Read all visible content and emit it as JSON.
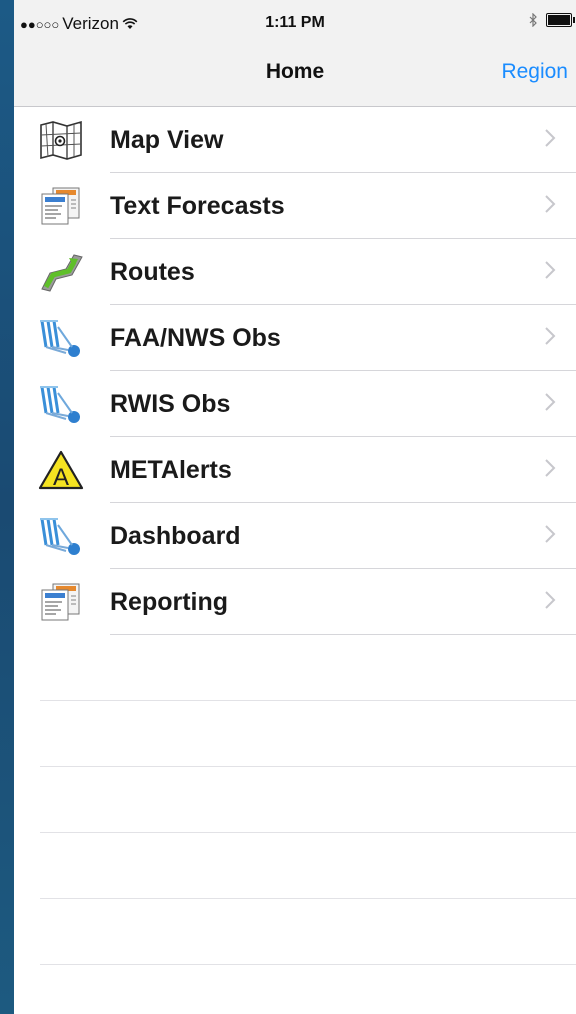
{
  "status": {
    "carrier": "Verizon",
    "time": "1:11 PM"
  },
  "nav": {
    "title": "Home",
    "right_button": "Region"
  },
  "menu": [
    {
      "label": "Map View",
      "icon": "map-icon"
    },
    {
      "label": "Text Forecasts",
      "icon": "document-icon"
    },
    {
      "label": "Routes",
      "icon": "route-arrow-icon"
    },
    {
      "label": "FAA/NWS Obs",
      "icon": "weather-station-icon"
    },
    {
      "label": "RWIS Obs",
      "icon": "weather-station-icon"
    },
    {
      "label": "METAlerts",
      "icon": "alert-triangle-icon"
    },
    {
      "label": "Dashboard",
      "icon": "weather-station-icon"
    },
    {
      "label": "Reporting",
      "icon": "document-icon"
    }
  ],
  "colors": {
    "accent": "#1a8cff",
    "background": "#1d4f78"
  }
}
